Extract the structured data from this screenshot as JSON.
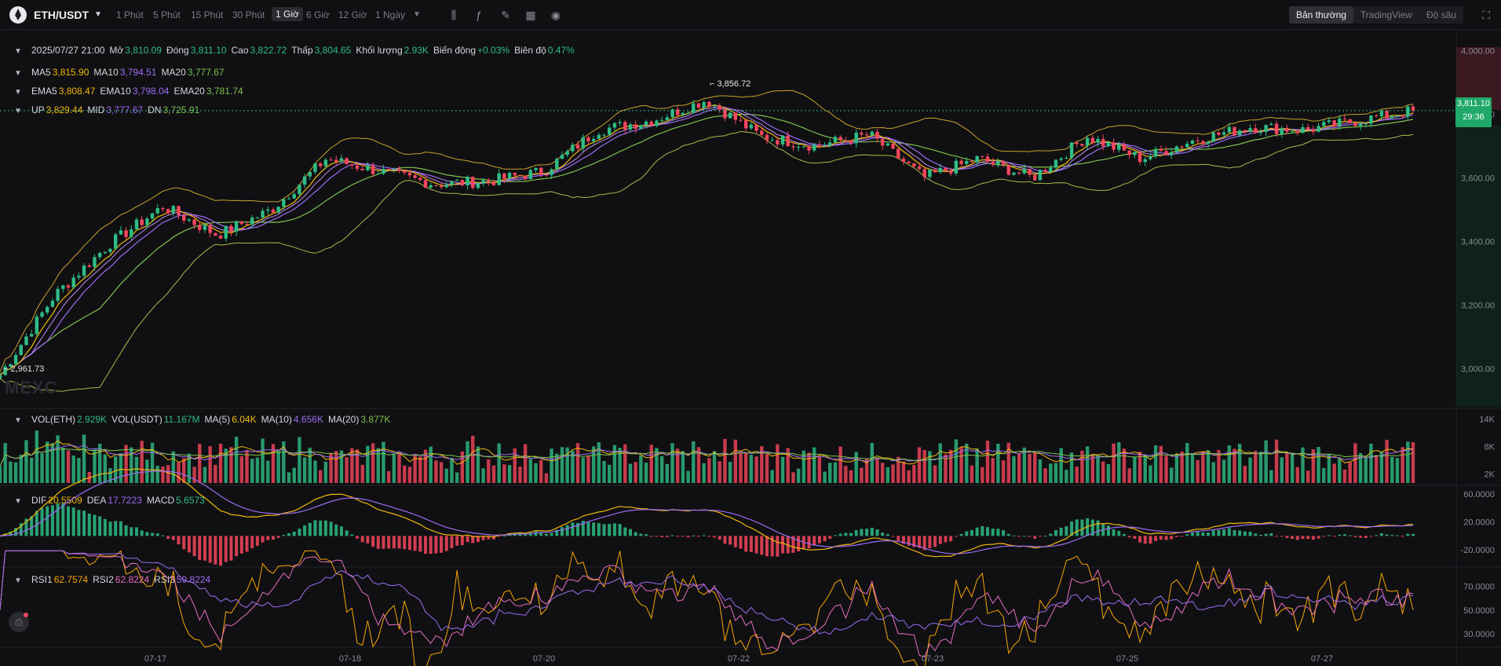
{
  "header": {
    "symbol": "ETH/USDT",
    "timeframes": [
      "1 Phút",
      "5 Phút",
      "15 Phút",
      "30 Phút",
      "1 Giờ",
      "6 Giờ",
      "12 Giờ",
      "1 Ngày"
    ],
    "active_timeframe": "1 Giờ",
    "views": [
      "Bản thường",
      "TradingView",
      "Độ sâu"
    ],
    "active_view": "Bản thường",
    "tool_icons": [
      "candle-type-icon",
      "indicator-icon",
      "draw-icon",
      "layout-icon",
      "camera-icon"
    ]
  },
  "ohlc": {
    "date": "2025/07/27 21:00",
    "open_label": "Mở",
    "open": "3,810.09",
    "close_label": "Đóng",
    "close": "3,811.10",
    "high_label": "Cao",
    "high": "3,822.72",
    "low_label": "Thấp",
    "low": "3,804.65",
    "vol_label": "Khối lượng",
    "vol": "2.93K",
    "change_label": "Biến động",
    "change": "+0.03%",
    "amp_label": "Biên độ",
    "amp": "0.47%"
  },
  "ma_legend": {
    "ma5_label": "MA5",
    "ma5": "3,815.90",
    "ma10_label": "MA10",
    "ma10": "3,794.51",
    "ma20_label": "MA20",
    "ma20": "3,777.67"
  },
  "ema_legend": {
    "ema5_label": "EMA5",
    "ema5": "3,808.47",
    "ema10_label": "EMA10",
    "ema10": "3,798.04",
    "ema20_label": "EMA20",
    "ema20": "3,781.74"
  },
  "boll_legend": {
    "up_label": "UP",
    "up": "3,829.44",
    "mid_label": "MID",
    "mid": "3,777.67",
    "dn_label": "DN",
    "dn": "3,725.91"
  },
  "vol_legend": {
    "eth_label": "VOL(ETH)",
    "eth": "2.929K",
    "usdt_label": "VOL(USDT)",
    "usdt": "11.167M",
    "ma5_label": "MA(5)",
    "ma5": "6.04K",
    "ma10_label": "MA(10)",
    "ma10": "4.656K",
    "ma20_label": "MA(20)",
    "ma20": "3.877K"
  },
  "macd_legend": {
    "dif_label": "DIF",
    "dif": "20.5509",
    "dea_label": "DEA",
    "dea": "17.7223",
    "macd_label": "MACD",
    "macd": "5.6573"
  },
  "rsi_legend": {
    "rsi1_label": "RSI1",
    "rsi1": "62.7574",
    "rsi2_label": "RSI2",
    "rsi2": "62.8224",
    "rsi3_label": "RSI3",
    "rsi3": "59.8224"
  },
  "price_axis": [
    "4,000.00",
    "3,800.00",
    "3,600.00",
    "3,400.00",
    "3,200.00",
    "3,000.00"
  ],
  "vol_axis": [
    "14K",
    "8K",
    "2K"
  ],
  "macd_axis": [
    "60.0000",
    "20.0000",
    "-20.0000"
  ],
  "rsi_axis": [
    "70.0000",
    "50.0000",
    "30.0000"
  ],
  "last_price": "3,811.10",
  "countdown": "29:36",
  "high_marker": "3,856.72",
  "low_marker": "2,961.73",
  "watermark": "MEXC",
  "colors": {
    "up": "#2ebd85",
    "down": "#f6465d",
    "ma5": "#f0b90b",
    "ma10": "#9d6cf2",
    "ma20": "#7ec24d",
    "boll": "#c9a227"
  },
  "chart_data": {
    "type": "candlestick",
    "x_ticks": [
      "07-17",
      "07-18",
      "07-20",
      "07-22",
      "07-23",
      "07-25",
      "07-27"
    ],
    "close_series_anchors": [
      {
        "x": "07-16 06:00",
        "price": 2980
      },
      {
        "x": "07-16 20:00",
        "price": 3230
      },
      {
        "x": "07-17 06:00",
        "price": 3390
      },
      {
        "x": "07-17 12:00",
        "price": 3510
      },
      {
        "x": "07-17 18:00",
        "price": 3420
      },
      {
        "x": "07-18 00:00",
        "price": 3500
      },
      {
        "x": "07-18 06:00",
        "price": 3660
      },
      {
        "x": "07-18 14:00",
        "price": 3620
      },
      {
        "x": "07-19 00:00",
        "price": 3580
      },
      {
        "x": "07-19 12:00",
        "price": 3590
      },
      {
        "x": "07-20 00:00",
        "price": 3620
      },
      {
        "x": "07-20 12:00",
        "price": 3750
      },
      {
        "x": "07-21 12:00",
        "price": 3780
      },
      {
        "x": "07-21 22:00",
        "price": 3845
      },
      {
        "x": "07-22 12:00",
        "price": 3730
      },
      {
        "x": "07-22 22:00",
        "price": 3700
      },
      {
        "x": "07-23 06:00",
        "price": 3735
      },
      {
        "x": "07-23 20:00",
        "price": 3600
      },
      {
        "x": "07-24 06:00",
        "price": 3660
      },
      {
        "x": "07-24 14:00",
        "price": 3600
      },
      {
        "x": "07-24 22:00",
        "price": 3730
      },
      {
        "x": "07-25 06:00",
        "price": 3660
      },
      {
        "x": "07-25 14:00",
        "price": 3720
      },
      {
        "x": "07-26 00:00",
        "price": 3760
      },
      {
        "x": "07-26 12:00",
        "price": 3750
      },
      {
        "x": "07-27 12:00",
        "price": 3780
      },
      {
        "x": "07-27 21:00",
        "price": 3811
      }
    ],
    "price_range": [
      2880,
      4060
    ],
    "macd_range": [
      -40,
      70
    ],
    "vol_max_k": 16,
    "rsi_range": [
      20,
      85
    ],
    "series": [
      {
        "name": "MA5"
      },
      {
        "name": "MA10"
      },
      {
        "name": "MA20"
      },
      {
        "name": "UP"
      },
      {
        "name": "MID"
      },
      {
        "name": "DN"
      }
    ]
  }
}
